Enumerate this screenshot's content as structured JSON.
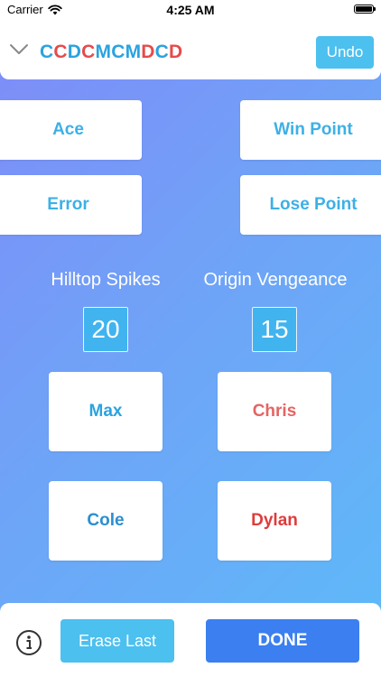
{
  "status_bar": {
    "carrier": "Carrier",
    "time": "4:25 AM",
    "icons": [
      "wifi-icon",
      "battery-icon"
    ]
  },
  "header": {
    "sequence": [
      {
        "letter": "C",
        "team": "blue"
      },
      {
        "letter": "C",
        "team": "red"
      },
      {
        "letter": "D",
        "team": "blue"
      },
      {
        "letter": "C",
        "team": "red"
      },
      {
        "letter": "M",
        "team": "blue"
      },
      {
        "letter": "C",
        "team": "blue"
      },
      {
        "letter": "M",
        "team": "blue"
      },
      {
        "letter": "D",
        "team": "red"
      },
      {
        "letter": "C",
        "team": "blue"
      },
      {
        "letter": "D",
        "team": "red"
      }
    ],
    "undo_label": "Undo",
    "icon": "chevron-down-icon"
  },
  "actions": {
    "ace": "Ace",
    "error": "Error",
    "win_point": "Win Point",
    "lose_point": "Lose Point"
  },
  "teams": {
    "home": {
      "name": "Hilltop Spikes",
      "score": "20"
    },
    "away": {
      "name": "Origin Vengeance",
      "score": "15"
    }
  },
  "players": {
    "home": [
      "Max",
      "Cole"
    ],
    "away": [
      "Chris",
      "Dylan"
    ]
  },
  "footer": {
    "erase_label": "Erase Last",
    "done_label": "DONE",
    "icon": "info-icon"
  },
  "colors": {
    "blue_team": "#2aa3e0",
    "red_team": "#e64b4b",
    "accent": "#4cc0ef",
    "done": "#3b7ff0"
  }
}
